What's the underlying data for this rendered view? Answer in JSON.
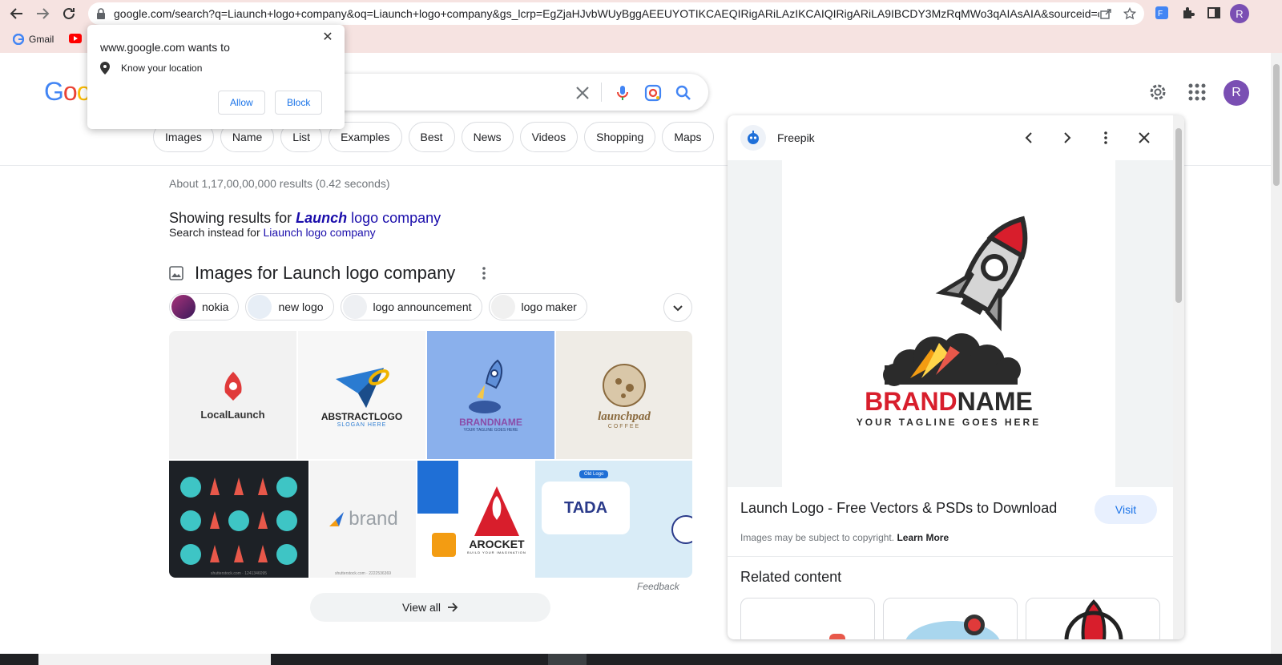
{
  "browser": {
    "url": "google.com/search?q=Liaunch+logo+company&oq=Liaunch+logo+company&gs_lcrp=EgZjaHJvbWUyBggAEEUYOTIKCAEQIRigARiLAzIKCAIQIRigARiLA9IBCDY3MzRqMWo3qAIAsAIA&sourceid=c...",
    "profile_initial": "R",
    "bookmarks": [
      {
        "label": "Gmail"
      },
      {
        "label": ""
      }
    ]
  },
  "popup": {
    "title": "www.google.com wants to",
    "permission": "Know your location",
    "allow_label": "Allow",
    "block_label": "Block"
  },
  "google": {
    "logo_partial": "Goo",
    "avatar_initial": "R",
    "tabs": [
      "Images",
      "Name",
      "List",
      "Examples",
      "Best",
      "News",
      "Videos",
      "Shopping",
      "Maps"
    ],
    "result_stats": "About 1,17,00,00,000 results (0.42 seconds)",
    "showing_prefix": "Showing results for ",
    "showing_bold": "Launch",
    "showing_rest": " logo company",
    "instead_prefix": "Search instead for ",
    "instead_link": "Liaunch logo company",
    "images_title": "Images for Launch logo company",
    "refine_chips": [
      "nokia",
      "new logo",
      "logo announcement",
      "logo maker"
    ],
    "tiles": {
      "t1": "LocalLaunch",
      "t2_main": "ABSTRACTLOGO",
      "t2_sub": "SLOGAN HERE",
      "t3_brand": "BRANDNAME",
      "t3_tag": "YOUR TAGLINE GOES HERE",
      "t4_main": "launchpad",
      "t4_sub": "COFFEE",
      "t5_label": "shutterstock.com · 1241346095",
      "t6_main": "brand",
      "t6_label": "shutterstock.com · 2222536369",
      "t8_main": "AROCKET",
      "t8_sub": "BUILD YOUR IMAGINATION",
      "t9_main": "TADA",
      "t9_badge": "Old Logo"
    },
    "feedback": "Feedback",
    "view_all": "View all"
  },
  "panel": {
    "source": "Freepik",
    "brand": "BRANDNAME",
    "tagline": "YOUR TAGLINE GOES HERE",
    "title": "Launch Logo - Free Vectors & PSDs to Download",
    "visit_label": "Visit",
    "copyright": "Images may be subject to copyright. ",
    "learn_more": "Learn More",
    "related_title": "Related content"
  },
  "colors": {
    "brand_red": "#d81e2c",
    "link_blue": "#1a0dab",
    "accent_blue": "#1a73e8",
    "avatar_purple": "#7a4fb3",
    "chrome_tint": "#f6e3e1"
  }
}
